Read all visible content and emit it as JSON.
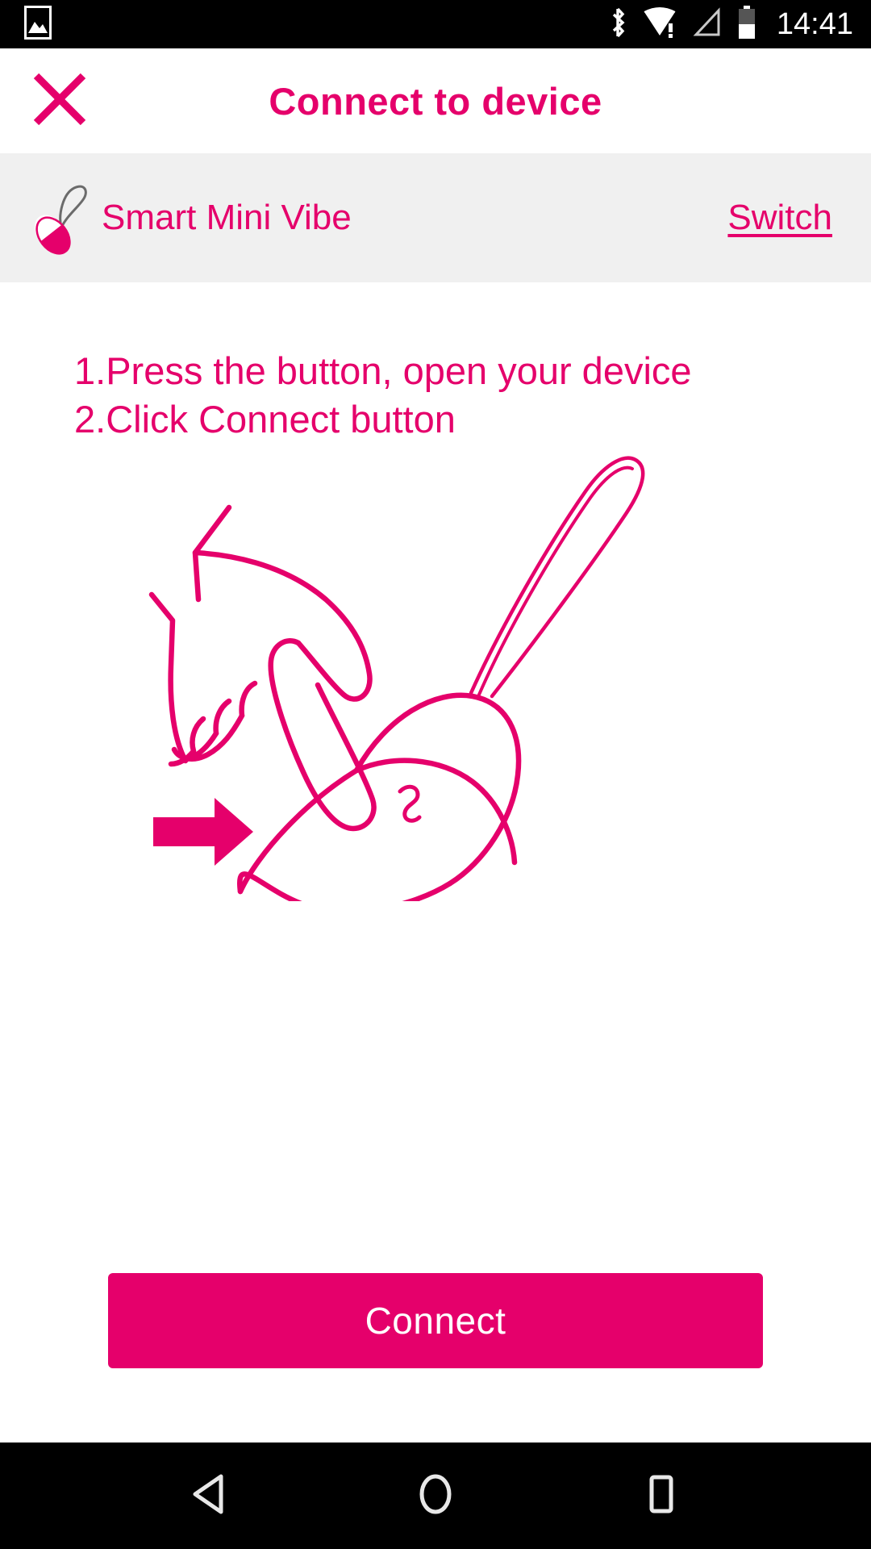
{
  "status_bar": {
    "time": "14:41",
    "icons": {
      "screenshot": "image-icon",
      "bluetooth": "bluetooth-icon",
      "wifi": "wifi-warning-icon",
      "signal": "signal-triangle-icon",
      "battery": "battery-icon"
    }
  },
  "header": {
    "title": "Connect to device",
    "close_icon": "close-x-icon"
  },
  "device": {
    "name": "Smart Mini Vibe",
    "switch_label": "Switch",
    "icon": "vibe-device-icon"
  },
  "instructions": [
    "1.Press the button, open your device",
    "2.Click Connect button"
  ],
  "illustration": {
    "name": "press-button-hand-illustration",
    "arrow_icon": "right-arrow-icon"
  },
  "footer": {
    "connect_label": "Connect"
  },
  "nav_bar": {
    "back_icon": "back-triangle-icon",
    "home_icon": "home-circle-icon",
    "recents_icon": "recents-square-icon"
  },
  "colors": {
    "accent": "#E5006B",
    "device_row_bg": "#f0f0f0",
    "status_bar_bg": "#000000",
    "page_bg": "#ffffff",
    "button_text": "#ffffff"
  }
}
